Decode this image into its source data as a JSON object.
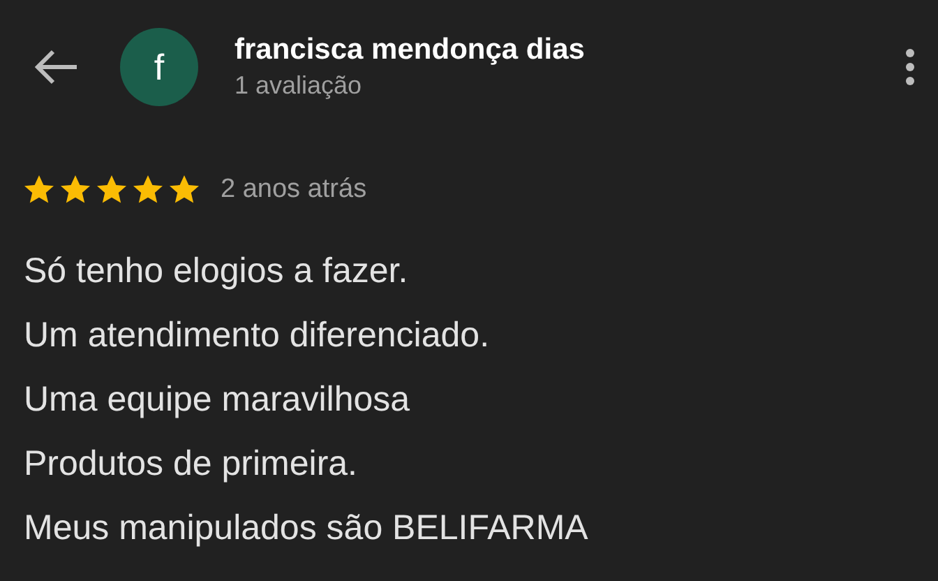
{
  "header": {
    "avatar_letter": "f",
    "name": "francisca mendonça dias",
    "subtitle": "1 avaliação"
  },
  "review": {
    "stars": 5,
    "time": "2 anos atrás",
    "lines": [
      "Só tenho elogios a fazer.",
      "Um atendimento diferenciado.",
      "Uma equipe maravilhosa",
      "Produtos de primeira.",
      "Meus manipulados são BELIFARMA"
    ]
  }
}
